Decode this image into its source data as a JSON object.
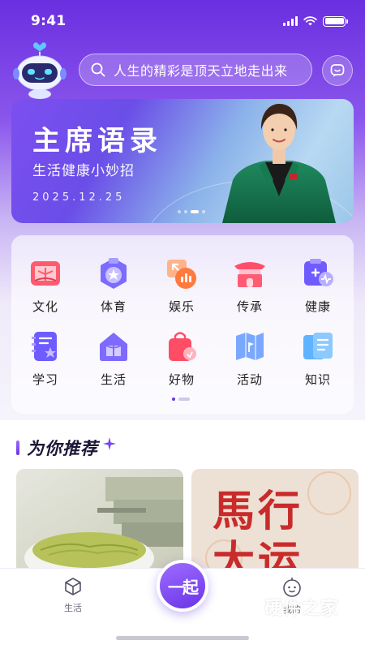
{
  "status": {
    "time": "9:41"
  },
  "search": {
    "placeholder": "人生的精彩是顶天立地走出来"
  },
  "banner": {
    "title": "主席语录",
    "subtitle": "生活健康小妙招",
    "date": "2025.12.25",
    "page_count": 4,
    "active_page": 3
  },
  "categories": [
    {
      "label": "文化",
      "icon": "culture-icon"
    },
    {
      "label": "体育",
      "icon": "sports-icon"
    },
    {
      "label": "娱乐",
      "icon": "entertainment-icon"
    },
    {
      "label": "传承",
      "icon": "heritage-icon"
    },
    {
      "label": "健康",
      "icon": "health-icon"
    },
    {
      "label": "学习",
      "icon": "study-icon"
    },
    {
      "label": "生活",
      "icon": "life-icon"
    },
    {
      "label": "好物",
      "icon": "goods-icon"
    },
    {
      "label": "活动",
      "icon": "activity-icon"
    },
    {
      "label": "知识",
      "icon": "knowledge-icon"
    }
  ],
  "section": {
    "title": "为你推荐"
  },
  "recommend": {
    "card2_text": "馬行大运"
  },
  "tabbar": {
    "left_label": "生活",
    "center_label": "一起",
    "right_label": "我的"
  },
  "watermark": {
    "text": "硬件之家",
    "sub": "YING JIAN ZHI JIA.COM"
  },
  "colors": {
    "primary": "#6a34e8",
    "accent": "#9e6dff"
  }
}
